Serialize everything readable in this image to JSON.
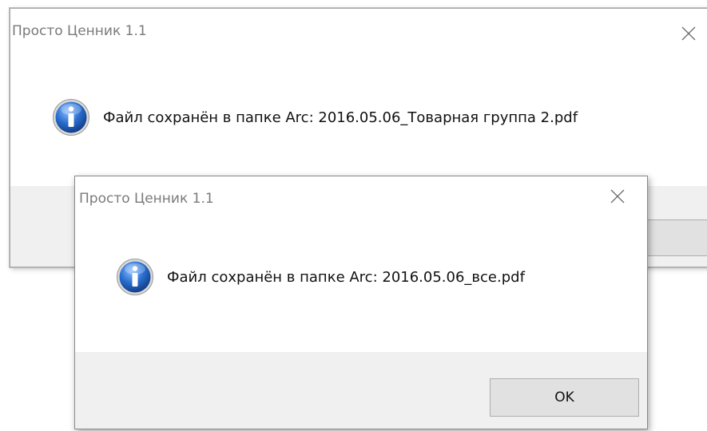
{
  "dialogs": {
    "back": {
      "title": "Просто Ценник 1.1",
      "message": "Файл сохранён в папке Arc: 2016.05.06_Товарная группа 2.pdf",
      "button_label": "",
      "icon": "info-icon"
    },
    "front": {
      "title": "Просто Ценник 1.1",
      "message": "Файл сохранён в папке Arc: 2016.05.06_все.pdf",
      "button_label": "OK",
      "icon": "info-icon"
    }
  },
  "colors": {
    "title_text": "#7a7a7a",
    "button_bar": "#f0f0f0",
    "button_face": "#e1e1e1",
    "icon_blue": "#1f5fb8"
  }
}
